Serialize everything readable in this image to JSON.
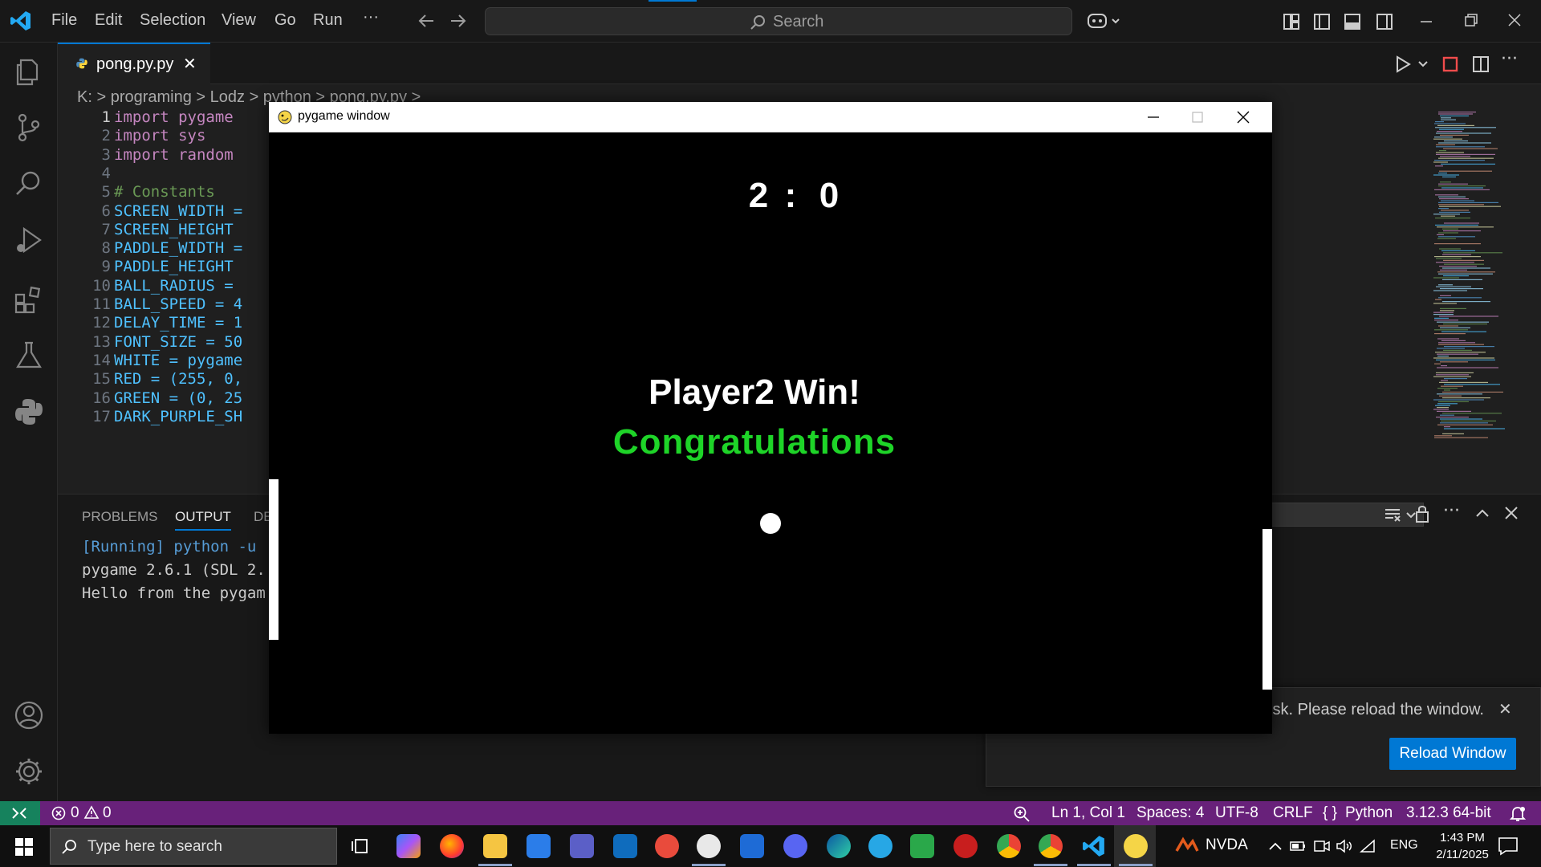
{
  "menu": {
    "items": [
      "File",
      "Edit",
      "Selection",
      "View",
      "Go",
      "Run"
    ],
    "more": "···"
  },
  "search": {
    "label": "Search"
  },
  "tab": {
    "filename": "pong.py.py",
    "close": "✕"
  },
  "breadcrumb": {
    "text": "K: > programing > Lodz > python > pong.py.py >"
  },
  "editor": {
    "lines": [
      {
        "n": "1",
        "text": "import pygame"
      },
      {
        "n": "2",
        "text": "import sys"
      },
      {
        "n": "3",
        "text": "import random"
      },
      {
        "n": "4",
        "text": ""
      },
      {
        "n": "5",
        "text": "# Constants"
      },
      {
        "n": "6",
        "text": "SCREEN_WIDTH ="
      },
      {
        "n": "7",
        "text": "SCREEN_HEIGHT"
      },
      {
        "n": "8",
        "text": "PADDLE_WIDTH ="
      },
      {
        "n": "9",
        "text": "PADDLE_HEIGHT"
      },
      {
        "n": "10",
        "text": "BALL_RADIUS ="
      },
      {
        "n": "11",
        "text": "BALL_SPEED = 4"
      },
      {
        "n": "12",
        "text": "DELAY_TIME = 1"
      },
      {
        "n": "13",
        "text": "FONT_SIZE = 50"
      },
      {
        "n": "14",
        "text": "WHITE = pygame"
      },
      {
        "n": "15",
        "text": "RED = (255, 0,"
      },
      {
        "n": "16",
        "text": "GREEN = (0, 25"
      },
      {
        "n": "17",
        "text": "DARK_PURPLE_SH"
      }
    ]
  },
  "panel": {
    "tabs": [
      "PROBLEMS",
      "OUTPUT",
      "DE"
    ],
    "output_lines": [
      "[Running] python -u",
      "pygame 2.6.1 (SDL 2.",
      "Hello from the pygam"
    ]
  },
  "pygame": {
    "window_title": "pygame window",
    "score_left": "2",
    "score_sep": ":",
    "score_right": "0",
    "winner_text": "Player2 Win!",
    "congrats_text": "Congratulations"
  },
  "notification": {
    "message": "isk. Please reload the window.",
    "button": "Reload Window",
    "close": "✕"
  },
  "statusbar": {
    "errors": "0",
    "warnings": "0",
    "position": "Ln 1, Col 1",
    "spaces": "Spaces: 4",
    "encoding": "UTF-8",
    "eol": "CRLF",
    "language": "Python",
    "language_prefix": "{ }",
    "interpreter": "3.12.3 64-bit"
  },
  "taskbar": {
    "search_placeholder": "Type here to search",
    "nvda": "NVDA",
    "lang": "ENG",
    "time": "1:43 PM",
    "date": "2/11/2025"
  },
  "colors": {
    "accent": "#0078d4",
    "statusbar": "#68217a",
    "remote": "#16825d",
    "congrats": "#1ed428"
  }
}
